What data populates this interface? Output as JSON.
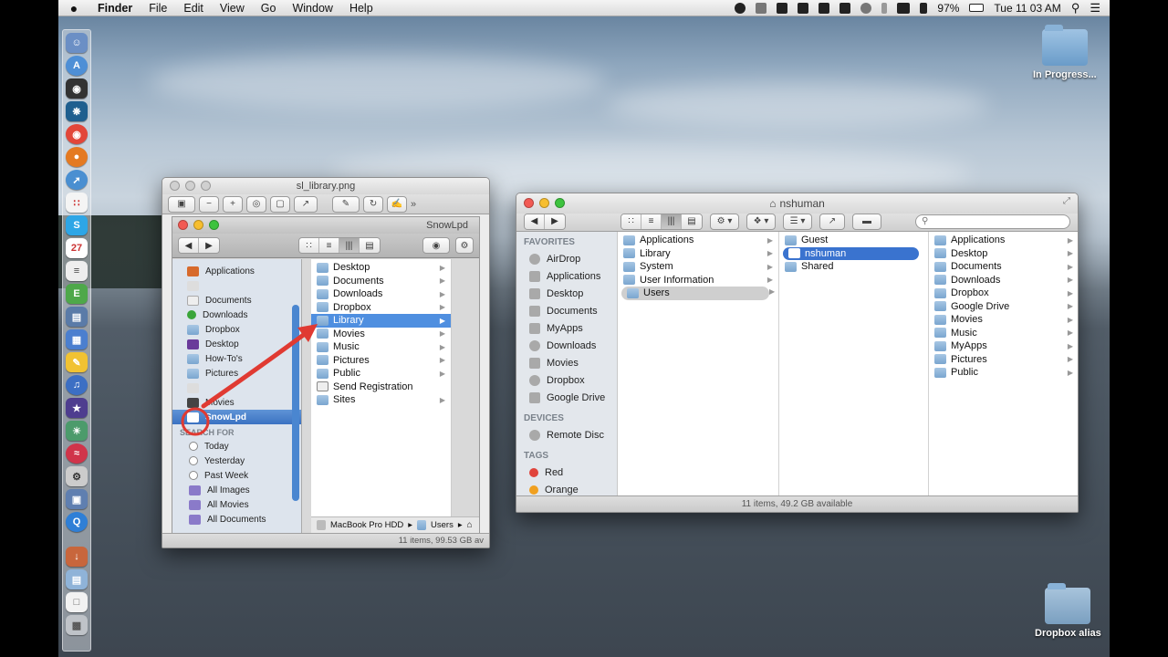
{
  "menubar": {
    "apple": "",
    "menus": [
      "Finder",
      "File",
      "Edit",
      "View",
      "Go",
      "Window",
      "Help"
    ],
    "battery": "97%",
    "clock": "Tue 11 03 AM"
  },
  "desktop": {
    "icon_top_label": "In Progress...",
    "icon_bottom_label": "Dropbox alias"
  },
  "preview_window": {
    "title": "sl_library.png",
    "inner_title": "SnowLpd",
    "sidebar": {
      "items": [
        "Applications",
        "",
        "Documents",
        "Downloads",
        "Dropbox",
        "Desktop",
        "How-To's",
        "Pictures",
        "",
        "Movies",
        "SnowLpd"
      ],
      "search_header": "SEARCH FOR",
      "search_items": [
        "Today",
        "Yesterday",
        "Past Week",
        "All Images",
        "All Movies",
        "All Documents"
      ]
    },
    "column": [
      "Desktop",
      "Documents",
      "Downloads",
      "Dropbox",
      "Library",
      "Movies",
      "Music",
      "Pictures",
      "Public",
      "Send Registration",
      "Sites"
    ],
    "path": [
      "MacBook Pro HDD",
      "Users"
    ],
    "status": "11 items, 99.53 GB av"
  },
  "finder_window": {
    "title": "nshuman",
    "search_placeholder": "",
    "sidebar": {
      "favorites_header": "FAVORITES",
      "favorites": [
        "AirDrop",
        "Applications",
        "Desktop",
        "Documents",
        "MyApps",
        "Downloads",
        "Movies",
        "Dropbox",
        "Google Drive"
      ],
      "devices_header": "DEVICES",
      "devices": [
        "Remote Disc"
      ],
      "tags_header": "TAGS",
      "tags": [
        {
          "name": "Red",
          "color": "#e0443c"
        },
        {
          "name": "Orange",
          "color": "#f0a020"
        }
      ]
    },
    "col1": [
      "Applications",
      "Library",
      "System",
      "User Information",
      "Users"
    ],
    "col2": [
      "Guest",
      "nshuman",
      "Shared"
    ],
    "col3": [
      "Applications",
      "Desktop",
      "Documents",
      "Downloads",
      "Dropbox",
      "Google Drive",
      "Movies",
      "Music",
      "MyApps",
      "Pictures",
      "Public"
    ],
    "status": "11 items, 49.2 GB available"
  },
  "colors": {
    "selection": "#3a73cf",
    "annotation": "#e03a32"
  }
}
